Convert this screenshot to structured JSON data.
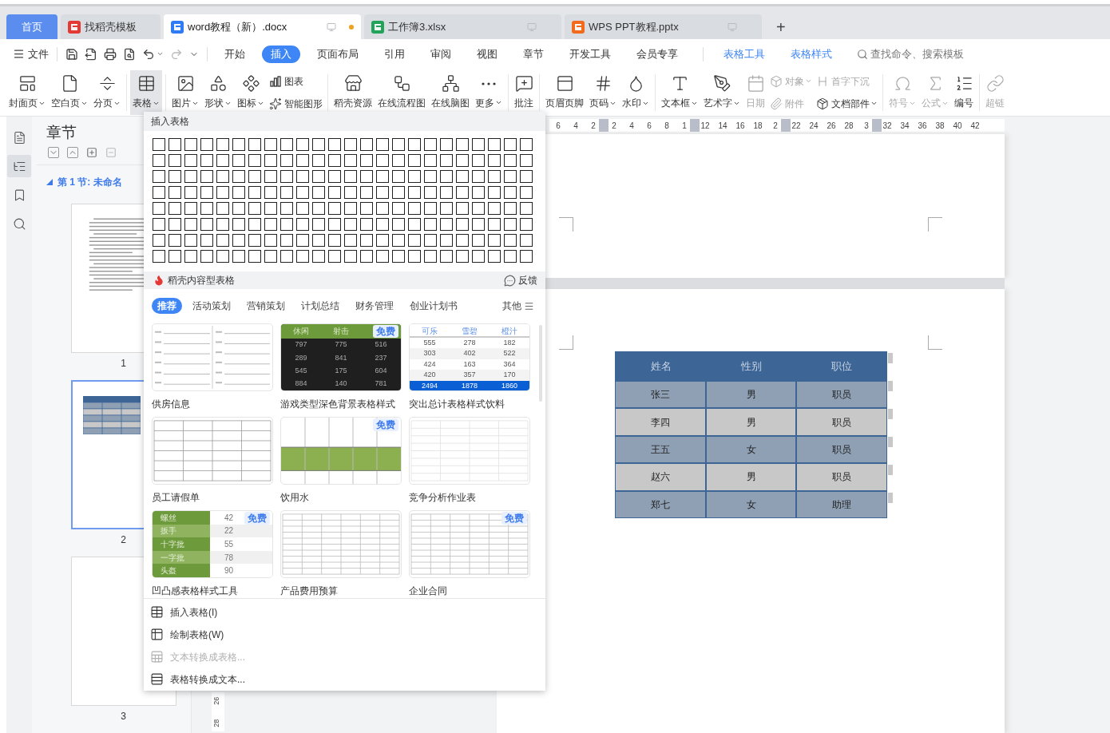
{
  "tabs": [
    {
      "label": "首页",
      "kind": "home",
      "selected": false
    },
    {
      "label": "找稻壳模板",
      "kind": "docer",
      "selected": false
    },
    {
      "label": "word教程（新）.docx",
      "kind": "word",
      "selected": true,
      "modified": true
    },
    {
      "label": "工作簿3.xlsx",
      "kind": "sheet",
      "selected": false,
      "modified": false
    },
    {
      "label": "WPS PPT教程.pptx",
      "kind": "ppt",
      "selected": false,
      "modified": false
    }
  ],
  "new_tab": "+",
  "menu": {
    "file": "文件",
    "tabs": [
      {
        "label": "开始",
        "kind": "main",
        "selected": false
      },
      {
        "label": "插入",
        "kind": "main",
        "selected": true
      },
      {
        "label": "页面布局",
        "kind": "main",
        "selected": false
      },
      {
        "label": "引用",
        "kind": "main",
        "selected": false
      },
      {
        "label": "审阅",
        "kind": "main",
        "selected": false
      },
      {
        "label": "视图",
        "kind": "main",
        "selected": false
      },
      {
        "label": "章节",
        "kind": "main",
        "selected": false
      },
      {
        "label": "开发工具",
        "kind": "main",
        "selected": false
      },
      {
        "label": "会员专享",
        "kind": "main",
        "selected": false
      },
      {
        "label": "表格工具",
        "kind": "context",
        "selected": false
      },
      {
        "label": "表格样式",
        "kind": "context",
        "selected": false
      }
    ],
    "search": {
      "placeholder": "查找命令、搜索模板"
    }
  },
  "ribbon": [
    [
      {
        "label": "封面页",
        "kind": "big",
        "dropdown": true,
        "disabled": false,
        "pressed": false
      },
      {
        "label": "空白页",
        "kind": "big",
        "dropdown": true,
        "disabled": false,
        "pressed": false
      },
      {
        "label": "分页",
        "kind": "big",
        "dropdown": true,
        "disabled": false,
        "pressed": false
      }
    ],
    [
      {
        "label": "表格",
        "kind": "big",
        "dropdown": true,
        "disabled": false,
        "pressed": true
      }
    ],
    [
      {
        "label": "图片",
        "kind": "big",
        "dropdown": true,
        "disabled": false,
        "pressed": false
      },
      {
        "label": "形状",
        "kind": "big",
        "dropdown": true,
        "disabled": false,
        "pressed": false
      },
      {
        "label": "图标",
        "kind": "big",
        "dropdown": true,
        "disabled": false,
        "pressed": false
      },
      {
        "label": "图表",
        "kind": "small",
        "dropdown": false,
        "disabled": false,
        "pressed": false
      },
      {
        "label": "智能图形",
        "kind": "small",
        "dropdown": false,
        "disabled": false,
        "pressed": false
      }
    ],
    [
      {
        "label": "稻壳资源",
        "kind": "big",
        "dropdown": false,
        "disabled": false,
        "pressed": false
      },
      {
        "label": "在线流程图",
        "kind": "big",
        "dropdown": false,
        "disabled": false,
        "pressed": false
      },
      {
        "label": "在线脑图",
        "kind": "big",
        "dropdown": false,
        "disabled": false,
        "pressed": false
      },
      {
        "label": "更多",
        "kind": "big",
        "dropdown": true,
        "disabled": false,
        "pressed": false
      }
    ],
    [
      {
        "label": "批注",
        "kind": "big",
        "dropdown": false,
        "disabled": false,
        "pressed": false
      }
    ],
    [
      {
        "label": "页眉页脚",
        "kind": "big",
        "dropdown": false,
        "disabled": false,
        "pressed": false
      },
      {
        "label": "页码",
        "kind": "big",
        "dropdown": true,
        "disabled": false,
        "pressed": false
      },
      {
        "label": "水印",
        "kind": "big",
        "dropdown": true,
        "disabled": false,
        "pressed": false
      }
    ],
    [
      {
        "label": "文本框",
        "kind": "big",
        "dropdown": true,
        "disabled": false,
        "pressed": false
      },
      {
        "label": "艺术字",
        "kind": "big",
        "dropdown": true,
        "disabled": false,
        "pressed": false
      },
      {
        "label": "日期",
        "kind": "big",
        "dropdown": false,
        "disabled": true,
        "pressed": false
      },
      {
        "label": "对象",
        "kind": "small",
        "dropdown": true,
        "disabled": true,
        "pressed": false
      },
      {
        "label": "附件",
        "kind": "small",
        "dropdown": false,
        "disabled": true,
        "pressed": false
      },
      {
        "label": "首字下沉",
        "kind": "small",
        "dropdown": false,
        "disabled": true,
        "pressed": false
      },
      {
        "label": "文档部件",
        "kind": "small",
        "dropdown": true,
        "disabled": false,
        "pressed": false
      }
    ],
    [
      {
        "label": "符号",
        "kind": "big",
        "dropdown": true,
        "disabled": true,
        "pressed": false
      },
      {
        "label": "公式",
        "kind": "big",
        "dropdown": true,
        "disabled": true,
        "pressed": false
      },
      {
        "label": "编号",
        "kind": "big",
        "dropdown": false,
        "disabled": false,
        "pressed": false
      }
    ],
    [
      {
        "label": "超链",
        "kind": "big",
        "dropdown": false,
        "disabled": true,
        "pressed": false
      }
    ]
  ],
  "sidebar_tools": [
    {
      "selected": false
    },
    {
      "selected": true
    },
    {
      "selected": false
    },
    {
      "selected": false
    }
  ],
  "nav": {
    "title": "章节",
    "section": {
      "label": "第 1 节: 未命名",
      "expanded": true
    },
    "pages": [
      {
        "number": "1",
        "kind": "text",
        "selected": false
      },
      {
        "number": "2",
        "kind": "table",
        "selected": true
      },
      {
        "number": "3",
        "kind": "blank",
        "selected": false
      }
    ]
  },
  "ruler": [
    {
      "kind": "tick",
      "label": "6"
    },
    {
      "kind": "tick",
      "label": "4"
    },
    {
      "kind": "tick",
      "label": "2"
    },
    {
      "kind": "marker"
    },
    {
      "kind": "tick",
      "label": "2"
    },
    {
      "kind": "tick",
      "label": "4"
    },
    {
      "kind": "tick",
      "label": "6"
    },
    {
      "kind": "tick",
      "label": "8"
    },
    {
      "kind": "tick",
      "label": "1"
    },
    {
      "kind": "marker"
    },
    {
      "kind": "tick",
      "label": "12"
    },
    {
      "kind": "tick",
      "label": "14"
    },
    {
      "kind": "tick",
      "label": "16"
    },
    {
      "kind": "tick",
      "label": "18"
    },
    {
      "kind": "tick",
      "label": "2"
    },
    {
      "kind": "marker"
    },
    {
      "kind": "tick",
      "label": "22"
    },
    {
      "kind": "tick",
      "label": "24"
    },
    {
      "kind": "tick",
      "label": "26"
    },
    {
      "kind": "tick",
      "label": "28"
    },
    {
      "kind": "tick",
      "label": "3"
    },
    {
      "kind": "marker"
    },
    {
      "kind": "tick",
      "label": "32"
    },
    {
      "kind": "tick",
      "label": "34"
    },
    {
      "kind": "tick",
      "label": "36"
    },
    {
      "kind": "tick",
      "label": "38"
    },
    {
      "kind": "tick",
      "label": "40"
    },
    {
      "kind": "tick",
      "label": "42"
    }
  ],
  "vertical_ruler": [
    "26",
    "28"
  ],
  "document_table": {
    "columns": [
      "姓名",
      "性别",
      "职位"
    ],
    "rows": [
      [
        "张三",
        "男",
        "职员"
      ],
      [
        "李四",
        "男",
        "职员"
      ],
      [
        "王五",
        "女",
        "职员"
      ],
      [
        "赵六",
        "男",
        "职员"
      ],
      [
        "郑七",
        "女",
        "助理"
      ]
    ]
  },
  "table_dropdown": {
    "title": "插入表格",
    "docer": {
      "title": "稻壳内容型表格",
      "feedback": "反馈"
    },
    "categories": [
      {
        "label": "推荐",
        "selected": true
      },
      {
        "label": "活动策划",
        "selected": false
      },
      {
        "label": "营销策划",
        "selected": false
      },
      {
        "label": "计划总结",
        "selected": false
      },
      {
        "label": "财务管理",
        "selected": false
      },
      {
        "label": "创业计划书",
        "selected": false
      }
    ],
    "more": "其他",
    "templates": [
      {
        "name": "供房信息",
        "kind": "form"
      },
      {
        "name": "游戏类型深色背景表格样式",
        "kind": "dark",
        "badge": "免费",
        "header": [
          "休闲",
          "射击"
        ],
        "rows": [
          [
            "797",
            "775",
            "516"
          ],
          [
            "289",
            "841",
            "237"
          ],
          [
            "545",
            "175",
            "604"
          ],
          [
            "884",
            "140",
            "781"
          ]
        ]
      },
      {
        "name": "突出总计表格样式饮料",
        "kind": "blue",
        "header": [
          "可乐",
          "雪碧",
          "橙汁"
        ],
        "rows": [
          [
            "555",
            "278",
            "182"
          ],
          [
            "303",
            "402",
            "522"
          ],
          [
            "424",
            "163",
            "364"
          ],
          [
            "420",
            "357",
            "170"
          ]
        ],
        "total": [
          "2494",
          "1878",
          "1860"
        ]
      },
      {
        "name": "员工请假单",
        "kind": "leave"
      },
      {
        "name": "饮用水",
        "kind": "water",
        "badge": "免费"
      },
      {
        "name": "竞争分析作业表",
        "kind": "analysis"
      },
      {
        "name": "凹凸感表格样式工具",
        "kind": "bars",
        "badge": "免费",
        "rows": [
          [
            "螺丝",
            "42"
          ],
          [
            "扳手",
            "22"
          ],
          [
            "十字批",
            "55"
          ],
          [
            "一字批",
            "78"
          ],
          [
            "头盔",
            "90"
          ]
        ]
      },
      {
        "name": "产品费用预算",
        "kind": "lines"
      },
      {
        "name": "企业合同",
        "kind": "lines",
        "badge": "免费"
      }
    ],
    "commands": [
      {
        "label": "插入表格(I)",
        "disabled": false
      },
      {
        "label": "绘制表格(W)",
        "disabled": false
      },
      {
        "label": "文本转换成表格...",
        "disabled": true
      },
      {
        "label": "表格转换成文本...",
        "disabled": false
      }
    ]
  }
}
